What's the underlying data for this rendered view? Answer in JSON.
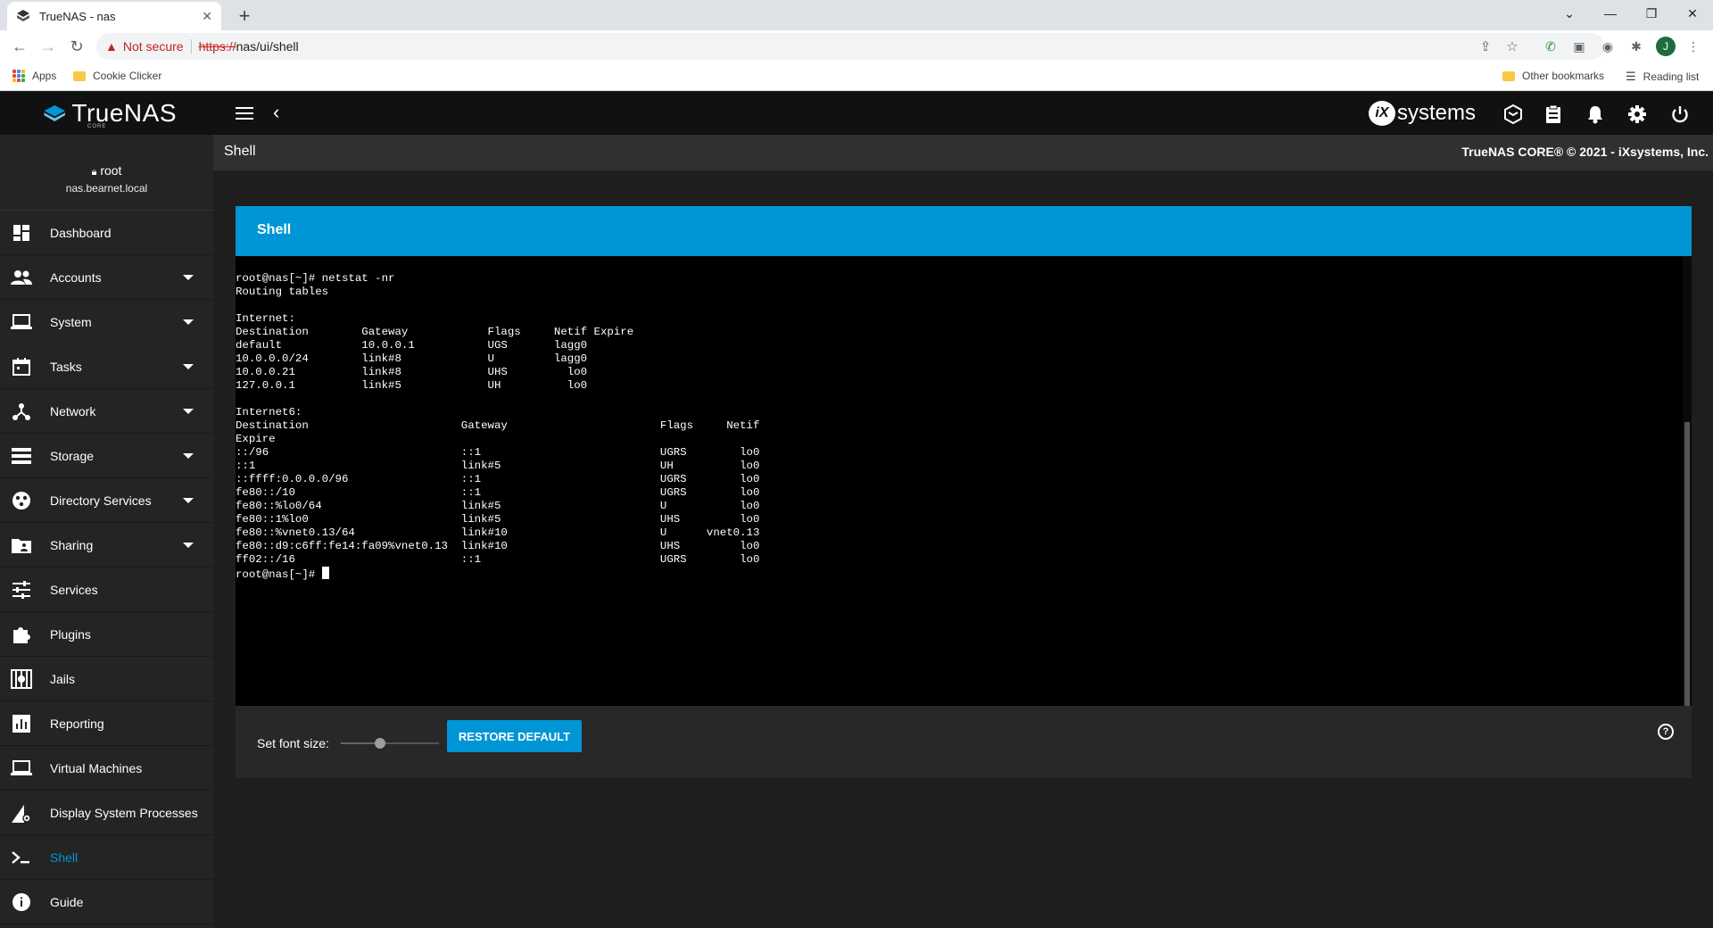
{
  "browser": {
    "tab_title": "TrueNAS - nas",
    "tab_close": "✕",
    "new_tab": "+",
    "security_label": "Not secure",
    "url_scheme": "https://",
    "url_rest": "nas/ui/shell",
    "profile_initial": "J",
    "bookmarks": {
      "apps": "Apps",
      "cookie_clicker": "Cookie Clicker",
      "other": "Other bookmarks",
      "reading_list": "Reading list"
    }
  },
  "header": {
    "logo_text": "TrueNAS",
    "logo_sub": "CORE",
    "ix_text": "systems",
    "ix_mark": "iX"
  },
  "user": {
    "name": "root",
    "host": "nas.bearnet.local"
  },
  "sidebar": {
    "items": [
      {
        "label": "Dashboard"
      },
      {
        "label": "Accounts"
      },
      {
        "label": "System"
      },
      {
        "label": "Tasks"
      },
      {
        "label": "Network"
      },
      {
        "label": "Storage"
      },
      {
        "label": "Directory Services"
      },
      {
        "label": "Sharing"
      },
      {
        "label": "Services"
      },
      {
        "label": "Plugins"
      },
      {
        "label": "Jails"
      },
      {
        "label": "Reporting"
      },
      {
        "label": "Virtual Machines"
      },
      {
        "label": "Display System Processes"
      },
      {
        "label": "Shell"
      },
      {
        "label": "Guide"
      }
    ]
  },
  "page": {
    "title": "Shell",
    "copyright": "TrueNAS CORE® © 2021 - iXsystems, Inc."
  },
  "card": {
    "title": "Shell"
  },
  "terminal": {
    "text": "root@nas[~]# netstat -nr\nRouting tables\n\nInternet:\nDestination        Gateway            Flags     Netif Expire\ndefault            10.0.0.1           UGS       lagg0\n10.0.0.0/24        link#8             U         lagg0\n10.0.0.21          link#8             UHS         lo0\n127.0.0.1          link#5             UH          lo0\n\nInternet6:\nDestination                       Gateway                       Flags     Netif\nExpire\n::/96                             ::1                           UGRS        lo0\n::1                               link#5                        UH          lo0\n::ffff:0.0.0.0/96                 ::1                           UGRS        lo0\nfe80::/10                         ::1                           UGRS        lo0\nfe80::%lo0/64                     link#5                        U           lo0\nfe80::1%lo0                       link#5                        UHS         lo0\nfe80::%vnet0.13/64                link#10                       U      vnet0.13\nfe80::d9:c6ff:fe14:fa09%vnet0.13  link#10                       UHS         lo0\nff02::/16                         ::1                           UGRS        lo0\n",
    "prompt": "root@nas[~]# "
  },
  "controls": {
    "font_size_label": "Set font size:",
    "font_size_level": 0.4,
    "restore_label": "RESTORE DEFAULT",
    "help": "?"
  }
}
